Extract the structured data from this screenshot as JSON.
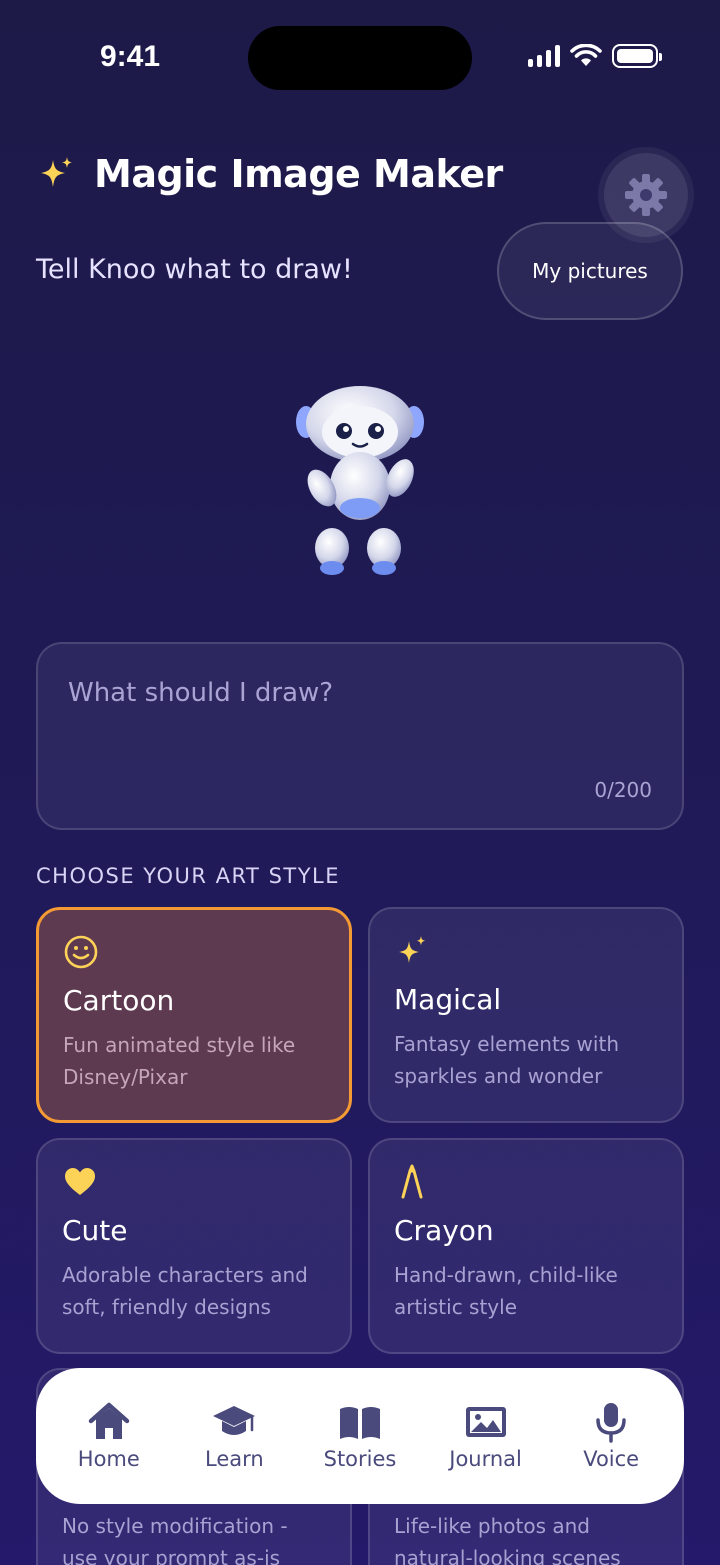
{
  "status_bar": {
    "time": "9:41"
  },
  "header": {
    "title": "Magic Image Maker",
    "subtitle": "Tell Knoo what to draw!",
    "my_pictures_label": "My pictures"
  },
  "prompt": {
    "placeholder": "What should I draw?",
    "char_count": "0/200"
  },
  "styles": {
    "section_label": "CHOOSE YOUR ART STYLE",
    "selected": "Cartoon",
    "items": [
      {
        "title": "Cartoon",
        "description": "Fun animated style like Disney/Pixar",
        "icon": "smiley-icon"
      },
      {
        "title": "Magical",
        "description": "Fantasy elements with sparkles and wonder",
        "icon": "sparkle-icon"
      },
      {
        "title": "Cute",
        "description": "Adorable characters and soft, friendly designs",
        "icon": "heart-icon"
      },
      {
        "title": "Crayon",
        "description": "Hand-drawn, child-like artistic style",
        "icon": "crayon-icon"
      },
      {
        "title": "",
        "description": "No style modification - use your prompt as-is",
        "icon": ""
      },
      {
        "title": "",
        "description": "Life-like photos and natural-looking scenes",
        "icon": ""
      }
    ]
  },
  "nav": {
    "items": [
      {
        "label": "Home",
        "icon": "home-icon"
      },
      {
        "label": "Learn",
        "icon": "graduation-cap-icon"
      },
      {
        "label": "Stories",
        "icon": "book-icon"
      },
      {
        "label": "Journal",
        "icon": "image-icon"
      },
      {
        "label": "Voice",
        "icon": "microphone-icon"
      }
    ]
  },
  "colors": {
    "accent": "#f49a34",
    "icon_yellow": "#fcd257",
    "nav_text": "#4a4a7c",
    "background": "#1f1a55"
  }
}
